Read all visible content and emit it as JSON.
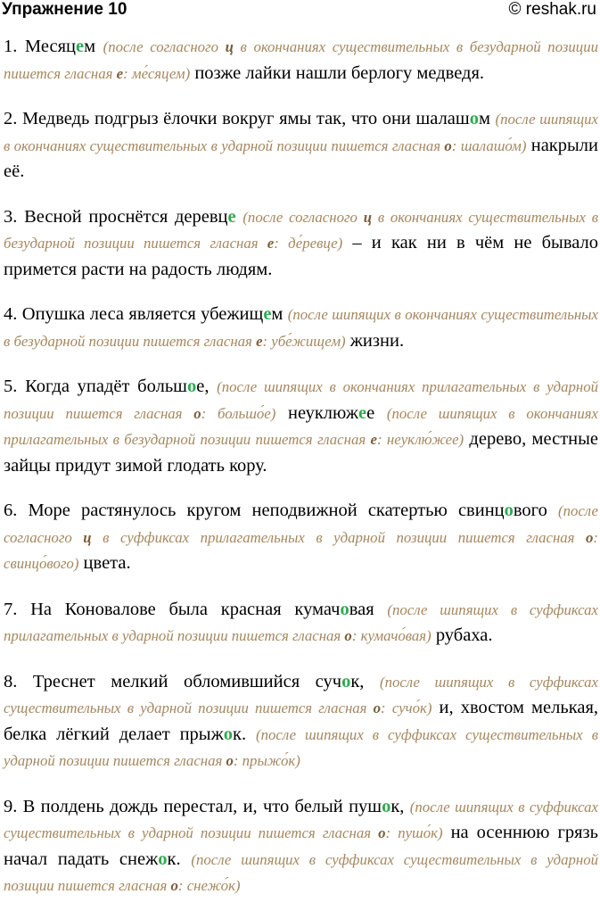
{
  "header": {
    "title": "Упражнение 10",
    "site": "© reshak.ru"
  },
  "items": [
    {
      "parts": [
        {
          "t": "1. Месяц"
        },
        {
          "t": "е",
          "h": 1
        },
        {
          "t": "м "
        },
        {
          "c": [
            {
              "t": "(после согласного "
            },
            {
              "t": "ц",
              "b": 1
            },
            {
              "t": " в окончаниях существительных в безударной позиции пишется гласная "
            },
            {
              "t": "е",
              "b": 1
            },
            {
              "t": ": ме́сяцем)"
            }
          ]
        },
        {
          "t": " позже лайки нашли берлогу медведя."
        }
      ]
    },
    {
      "parts": [
        {
          "t": "2. Медведь подгрыз ёлочки вокруг ямы так, что они шалаш"
        },
        {
          "t": "о",
          "h": 1
        },
        {
          "t": "м "
        },
        {
          "c": [
            {
              "t": "(после шипящих в окончаниях существительных в ударной позиции пишется гласная "
            },
            {
              "t": "о",
              "b": 1
            },
            {
              "t": ": шалашо́м)"
            }
          ]
        },
        {
          "t": " накрыли её."
        }
      ]
    },
    {
      "parts": [
        {
          "t": "3. Весной проснётся деревц"
        },
        {
          "t": "е",
          "h": 1
        },
        {
          "t": " "
        },
        {
          "c": [
            {
              "t": "(после согласного "
            },
            {
              "t": "ц",
              "b": 1
            },
            {
              "t": " в окончаниях существительных в безударной позиции пишется гласная "
            },
            {
              "t": "е",
              "b": 1
            },
            {
              "t": ": де́ревце)"
            }
          ]
        },
        {
          "t": " – и как ни в чём не бывало примется расти на радость людям."
        }
      ]
    },
    {
      "parts": [
        {
          "t": "4. Опушка леса является убежищ"
        },
        {
          "t": "е",
          "h": 1
        },
        {
          "t": "м "
        },
        {
          "c": [
            {
              "t": "(после шипящих в окончаниях существительных в безударной позиции пишется гласная "
            },
            {
              "t": "е",
              "b": 1
            },
            {
              "t": ": убе́жищем)"
            }
          ]
        },
        {
          "t": " жизни."
        }
      ]
    },
    {
      "parts": [
        {
          "t": "5. Когда упадёт больш"
        },
        {
          "t": "о",
          "h": 1
        },
        {
          "t": "е, "
        },
        {
          "c": [
            {
              "t": "(после шипящих в окончаниях прилагательных в ударной позиции пишется гласная "
            },
            {
              "t": "о",
              "b": 1
            },
            {
              "t": ": большо́е)"
            }
          ]
        },
        {
          "t": " неуклюж"
        },
        {
          "t": "е",
          "h": 1
        },
        {
          "t": "е "
        },
        {
          "c": [
            {
              "t": "(после шипящих в окончаниях прилагательных в безударной позиции пишется гласная "
            },
            {
              "t": "е",
              "b": 1
            },
            {
              "t": ": неуклю́жее)"
            }
          ]
        },
        {
          "t": " дерево, местные зайцы придут зимой глодать кору."
        }
      ]
    },
    {
      "parts": [
        {
          "t": "6. Море растянулось кругом неподвижной скатертью свинц"
        },
        {
          "t": "о",
          "h": 1
        },
        {
          "t": "вого "
        },
        {
          "c": [
            {
              "t": "(после согласного "
            },
            {
              "t": "ц",
              "b": 1
            },
            {
              "t": " в суффиксах прилагательных в ударной позиции пишется гласная "
            },
            {
              "t": "о",
              "b": 1
            },
            {
              "t": ": свинцо́вого)"
            }
          ]
        },
        {
          "t": " цвета."
        }
      ]
    },
    {
      "parts": [
        {
          "t": "7. На Коновалове была красная кумач"
        },
        {
          "t": "о",
          "h": 1
        },
        {
          "t": "вая "
        },
        {
          "c": [
            {
              "t": "(после шипящих в суффиксах прилагательных в ударной позиции пишется гласная "
            },
            {
              "t": "о",
              "b": 1
            },
            {
              "t": ": кумачо́вая)"
            }
          ]
        },
        {
          "t": " рубаха."
        }
      ]
    },
    {
      "parts": [
        {
          "t": "8. Треснет мелкий обломившийся суч"
        },
        {
          "t": "о",
          "h": 1
        },
        {
          "t": "к, "
        },
        {
          "c": [
            {
              "t": "(после шипящих в суффиксах существительных в ударной позиции пишется гласная "
            },
            {
              "t": "о",
              "b": 1
            },
            {
              "t": ": сучо́к)"
            }
          ]
        },
        {
          "t": " и, хвостом мелькая, белка лёгкий делает прыж"
        },
        {
          "t": "о",
          "h": 1
        },
        {
          "t": "к. "
        },
        {
          "c": [
            {
              "t": "(после шипящих в суффиксах существительных в ударной позиции пишется гласная "
            },
            {
              "t": "о",
              "b": 1
            },
            {
              "t": ": прыжо́к)"
            }
          ]
        }
      ]
    },
    {
      "parts": [
        {
          "t": "9. В полдень дождь перестал, и, что белый пуш"
        },
        {
          "t": "о",
          "h": 1
        },
        {
          "t": "к, "
        },
        {
          "c": [
            {
              "t": "(после шипящих в суффиксах существительных в ударной позиции пишется гласная "
            },
            {
              "t": "о",
              "b": 1
            },
            {
              "t": ": пушо́к)"
            }
          ]
        },
        {
          "t": " на осеннюю грязь начал падать снеж"
        },
        {
          "t": "о",
          "h": 1
        },
        {
          "t": "к. "
        },
        {
          "c": [
            {
              "t": "(после шипящих в суффиксах существительных в ударной позиции пишется гласная "
            },
            {
              "t": "о",
              "b": 1
            },
            {
              "t": ": снежо́к)"
            }
          ]
        }
      ]
    }
  ]
}
